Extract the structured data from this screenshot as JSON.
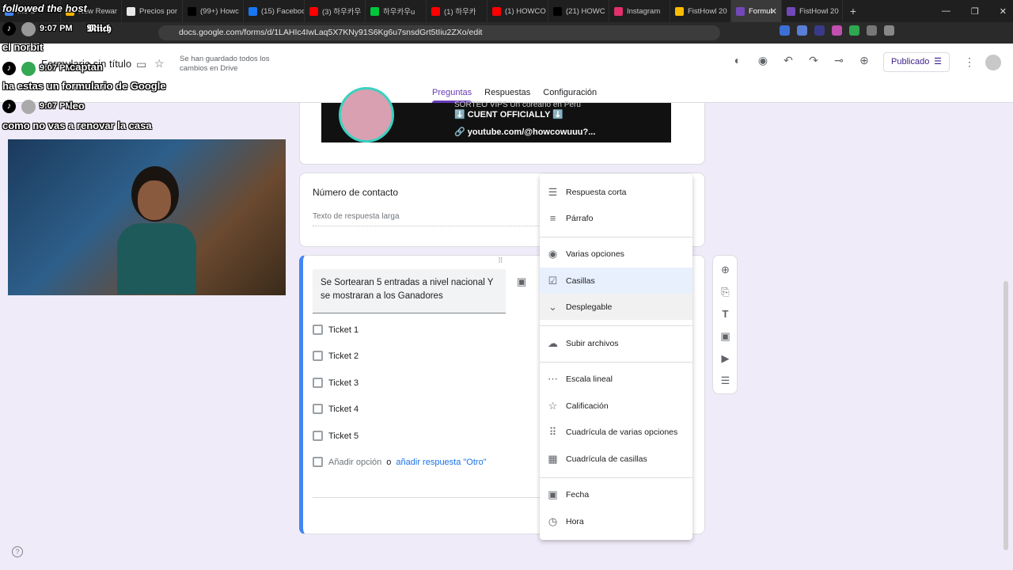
{
  "browser": {
    "tabs": [
      {
        "label": "mo O",
        "color": "#4285f4"
      },
      {
        "label": "New Rewar",
        "color": "#f4b400"
      },
      {
        "label": "Precios por",
        "color": "#e8e8e8"
      },
      {
        "label": "(99+) Howc",
        "color": "#000000"
      },
      {
        "label": "(15) Faceboo",
        "color": "#1877f2"
      },
      {
        "label": "(3) 하우카우",
        "color": "#ff0000"
      },
      {
        "label": "하우카우u",
        "color": "#00c73c"
      },
      {
        "label": "(1) 하우카",
        "color": "#ff0000"
      },
      {
        "label": "(1) HOWCO",
        "color": "#ff0000"
      },
      {
        "label": "(21) HOWC",
        "color": "#000000"
      },
      {
        "label": "Instagram",
        "color": "#e1306c"
      },
      {
        "label": "FistHowl 20",
        "color": "#fbbc04"
      },
      {
        "label": "Formul",
        "color": "#7248b9",
        "active": true
      },
      {
        "label": "FistHowl 20",
        "color": "#7248b9"
      }
    ],
    "new_tab": "+",
    "url": "docs.google.com/forms/d/1LAHIc4IwLaq5X7KNy91S6Kg6u7snsdGrt5tIiu2ZXo/edit",
    "window_controls": [
      "—",
      "❐",
      "✕"
    ]
  },
  "form": {
    "title": "Formulario sin título",
    "saved_status": "Se han guardado todos los cambios en Drive",
    "publish_label": "Publicado",
    "nav_tabs": [
      "Preguntas",
      "Respuestas",
      "Configuración"
    ],
    "banner_lines": [
      "SORTEO VIPS  Un coreano en Peru",
      "⬇️ CUENT OFFICIALLY ⬇️",
      "🔗 youtube.com/@howcowuuu?..."
    ],
    "contact_question": "Número de contacto",
    "contact_hint": "Texto de respuesta larga",
    "main_question": "Se Sortearan 5 entradas a nivel nacional Y se mostraran a los Ganadores",
    "options": [
      "Ticket 1",
      "Ticket 2",
      "Ticket 3",
      "Ticket 4",
      "Ticket 5"
    ],
    "add_option": "Añadir opción",
    "or_text": "o",
    "add_other": "añadir respuesta \"Otro\""
  },
  "type_menu": {
    "items": [
      {
        "label": "Respuesta corta",
        "icon": "short-text-icon",
        "glyph": "☰"
      },
      {
        "label": "Párrafo",
        "icon": "paragraph-icon",
        "glyph": "≡"
      },
      {
        "label": "Varias opciones",
        "icon": "radio-icon",
        "glyph": "◉"
      },
      {
        "label": "Casillas",
        "icon": "checkbox-icon",
        "glyph": "☑"
      },
      {
        "label": "Desplegable",
        "icon": "dropdown-icon",
        "glyph": "⌄"
      },
      {
        "label": "Subir archivos",
        "icon": "cloud-upload-icon",
        "glyph": "☁"
      },
      {
        "label": "Escala lineal",
        "icon": "linear-scale-icon",
        "glyph": "⋯"
      },
      {
        "label": "Calificación",
        "icon": "star-icon",
        "glyph": "☆"
      },
      {
        "label": "Cuadrícula de varias opciones",
        "icon": "radio-grid-icon",
        "glyph": "⠿"
      },
      {
        "label": "Cuadrícula de casillas",
        "icon": "checkbox-grid-icon",
        "glyph": "▦"
      },
      {
        "label": "Fecha",
        "icon": "calendar-icon",
        "glyph": "▣"
      },
      {
        "label": "Hora",
        "icon": "clock-icon",
        "glyph": "◷"
      }
    ]
  },
  "stream_overlay": {
    "chat": [
      {
        "text": "followed the host"
      },
      {
        "user": "𝕸𝖎𝖎𝖈𝖍",
        "time": "9:07 PM"
      },
      {
        "text": "el norbit"
      },
      {
        "user": "captan",
        "time": "9:07 PM"
      },
      {
        "text": "ha estas un formulario de Google"
      },
      {
        "user": "leo",
        "time": "9:07 PM"
      },
      {
        "text": "como no vas a renovar la casa"
      }
    ]
  }
}
